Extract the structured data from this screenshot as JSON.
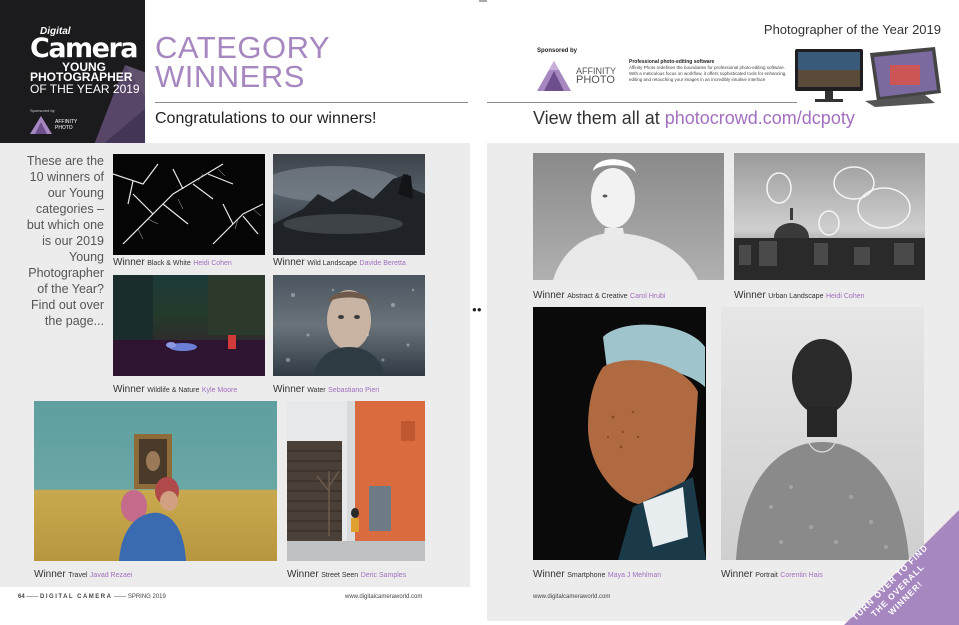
{
  "masthead": {
    "digital": "Digital",
    "camera": "Camera",
    "young": "YOUNG",
    "photographer": "PHOTOGRAPHER",
    "of_the_year": "OF THE YEAR 2019",
    "sponsor_label": "Sponsored by",
    "sponsor_logo_text": "AFFINITY PHOTO"
  },
  "left_page": {
    "headline_line1": "CATEGORY",
    "headline_line2": "WINNERS",
    "subhead": "Congratulations to our winners!",
    "intro": "These are the 10 winners of our Young categories – but which one is our 2019 Young Photographer of the Year? Find out over the page...",
    "folio": {
      "page_number": "64",
      "magazine": "DIGITAL CAMERA",
      "issue": "SPRING 2019",
      "website": "www.digitalcameraworld.com"
    },
    "winners": [
      {
        "label": "Winner",
        "category": "Black & White",
        "name": "Heidi Cohen"
      },
      {
        "label": "Winner",
        "category": "Wild Landscape",
        "name": "Davide Beretta"
      },
      {
        "label": "Winner",
        "category": "Wildlife & Nature",
        "name": "Kyle Moore"
      },
      {
        "label": "Winner",
        "category": "Water",
        "name": "Sebastiano Pieri"
      },
      {
        "label": "Winner",
        "category": "Travel",
        "name": "Javad Rezaei"
      },
      {
        "label": "Winner",
        "category": "Street Seen",
        "name": "Deric Samples"
      }
    ]
  },
  "right_page": {
    "title": "Photographer of the Year 2019",
    "sponsor": {
      "label": "Sponsored by",
      "logo_line1": "AFFINITY",
      "logo_line2": "PHOTO",
      "heading": "Professional photo-editing software",
      "description": "Affinity Photo redefines the boundaries for professional photo-editing software. With a meticulous focus on workflow, it offers sophisticated tools for enhancing, editing and retouching your images in an incredibly intuitive interface"
    },
    "view_text": "View them all at ",
    "view_link": "photocrowd.com/dcpoty",
    "folio_website": "www.digitalcameraworld.com",
    "corner_banner": "TURN OVER TO FIND THE OVERALL WINNER!",
    "winners": [
      {
        "label": "Winner",
        "category": "Abstract & Creative",
        "name": "Carol Hrubi"
      },
      {
        "label": "Winner",
        "category": "Urban Landscape",
        "name": "Heidi Cohen"
      },
      {
        "label": "Winner",
        "category": "Smartphone",
        "name": "Maya J Mehlman"
      },
      {
        "label": "Winner",
        "category": "Portrait",
        "name": "Corentin Hais"
      }
    ]
  },
  "colors": {
    "accent_purple": "#a787c0",
    "name_purple": "#a36fbf",
    "panel_gray": "#ececec",
    "masthead_black": "#1b1b1e"
  }
}
